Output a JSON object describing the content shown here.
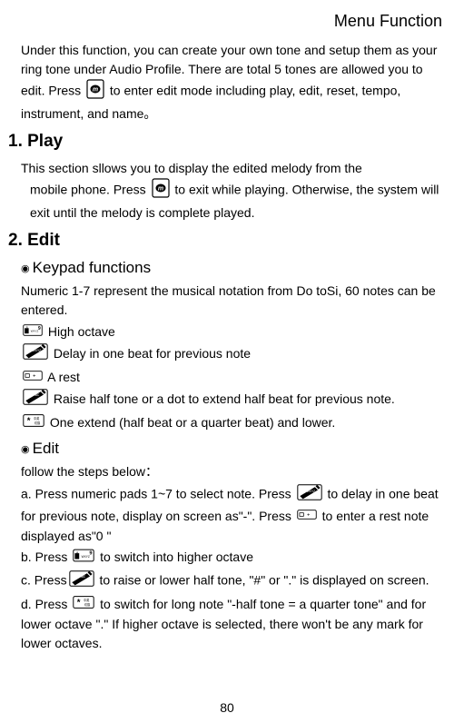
{
  "header": "Menu Function",
  "intro": {
    "p1a": "Under this function, you can create your own tone and setup them as your ring tone under Audio Profile.    There are total 5 tones are allowed you to edit.    Press ",
    "p1b": " to enter edit mode including play, edit, reset, tempo, instrument, and name。"
  },
  "sec1": {
    "title": "1. Play",
    "line1": "This section sllows you to display the edited melody from the",
    "line2a": "mobile phone. Press ",
    "line2b": " to exit while playing.    Otherwise, the system will exit until the melody is complete played."
  },
  "sec2": {
    "title": "2. Edit",
    "sub1": "Keypad functions",
    "kf_intro": "Numeric 1-7 represent the musical notation from Do toSi, 60 notes can be entered.",
    "kf1": " High octave",
    "kf2": " Delay in one beat for previous note",
    "kf3": " A rest",
    "kf4": " Raise half tone or a dot to extend half beat for previous note.",
    "kf5": " One extend (half beat or a quarter beat) and lower.",
    "sub2": "Edit",
    "edit_intro": "follow the steps below：",
    "step_a1": "a. Press numeric pads 1~7 to select note. Press ",
    "step_a2": " to delay in one beat for previous note, display on screen as\"-\". Press ",
    "step_a3": " to enter a rest note displayed as\"0 \"",
    "step_b1": "b. Press ",
    "step_b2": " to switch into higher octave",
    "step_c1": "c. Press",
    "step_c2": " to raise or lower half tone, \"#\" or \".\"    is displayed on screen.",
    "step_d1": "d. Press ",
    "step_d2": " to switch for long note \"-half tone = a quarter tone\" and for lower octave \".\" If higher octave is selected, there won't be any mark for lower octaves."
  },
  "page_number": "80"
}
